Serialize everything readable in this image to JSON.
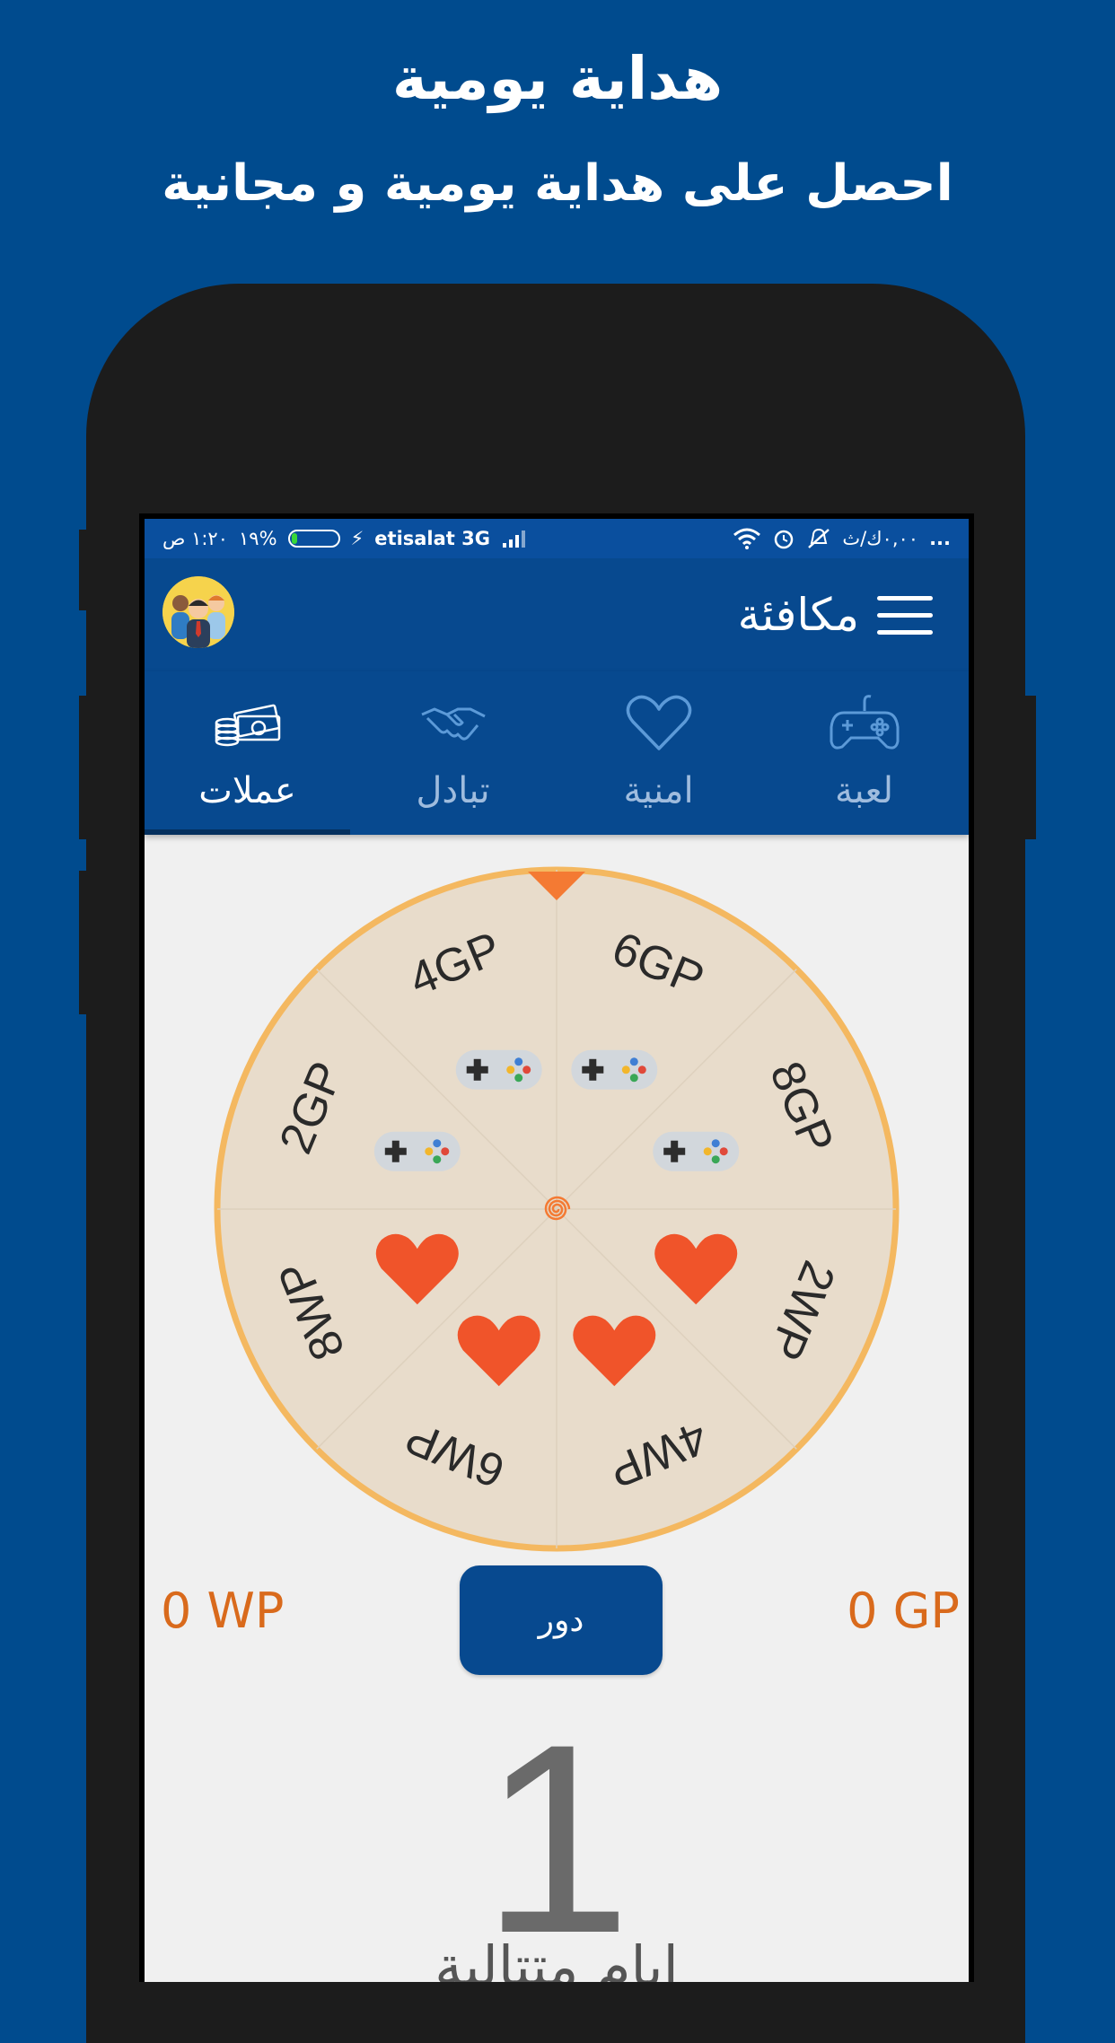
{
  "promo": {
    "title": "هداية يومية",
    "subtitle": "احصل على هداية يومية و مجانية"
  },
  "status_bar": {
    "time": "١:٢٠ ص",
    "battery": "١٩%",
    "battery_level": 0.19,
    "carrier": "etisalat 3G",
    "network_speed": "٠,٠٠ك/ث",
    "overflow": "..."
  },
  "app_bar": {
    "title": "مكافئة",
    "menu_icon": "hamburger-menu-icon",
    "avatar_icon": "users-group-avatar"
  },
  "tabs": [
    {
      "label": "عملات",
      "icon": "money-coins-icon",
      "active": true
    },
    {
      "label": "تبادل",
      "icon": "handshake-icon",
      "active": false
    },
    {
      "label": "امنية",
      "icon": "heart-outline-icon",
      "active": false
    },
    {
      "label": "لعبة",
      "icon": "gamepad-icon",
      "active": false
    }
  ],
  "wheel": {
    "segments": [
      "6GP",
      "8GP",
      "2WP",
      "4WP",
      "6WP",
      "8WP",
      "2GP",
      "4GP"
    ],
    "colors": {
      "rim": "#f4b860",
      "fill": "#e8dccb",
      "heart": "#f0542a",
      "pointer": "#f47a33"
    }
  },
  "spin_button": {
    "label": "دور"
  },
  "points": {
    "wp": "0 WP",
    "gp": "0 GP"
  },
  "streak": {
    "count": "1",
    "label": "ايام متتالية"
  }
}
